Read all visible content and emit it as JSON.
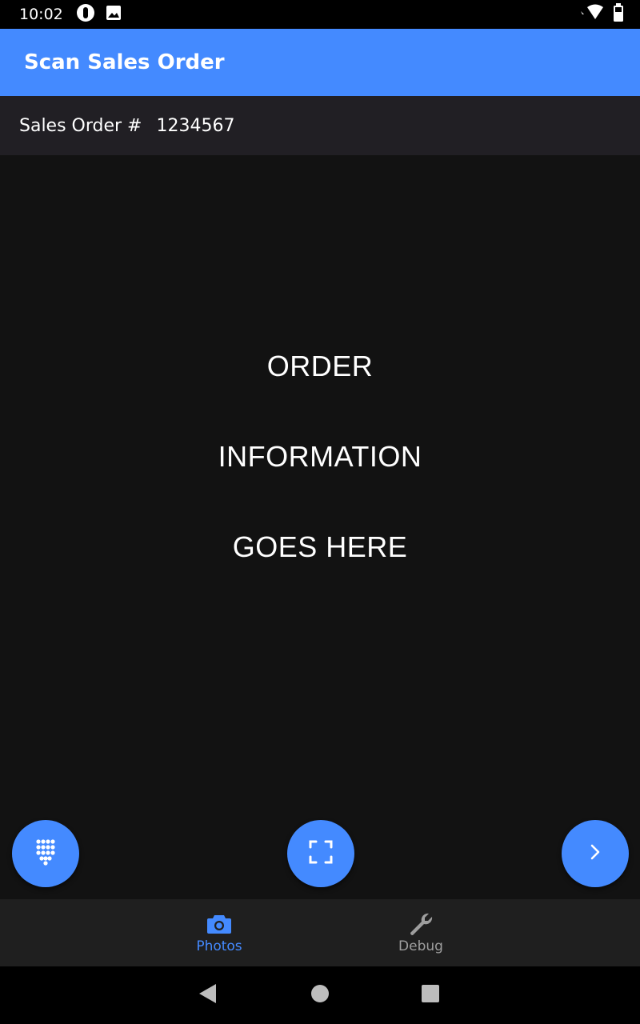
{
  "status_bar": {
    "time": "10:02",
    "left_icons": [
      "alert-icon",
      "image-icon"
    ],
    "right_icons": [
      "wifi-icon",
      "battery-icon"
    ]
  },
  "app_bar": {
    "title": "Scan Sales Order"
  },
  "order": {
    "label": "Sales Order #",
    "number": "1234567"
  },
  "main": {
    "lines": [
      "ORDER",
      "INFORMATION",
      "GOES HERE"
    ]
  },
  "fabs": {
    "left_icon": "dialpad-icon",
    "center_icon": "scan-frame-icon",
    "right_icon": "chevron-right-icon"
  },
  "bottom_nav": {
    "items": [
      {
        "label": "Photos",
        "icon": "camera-icon",
        "active": true
      },
      {
        "label": "Debug",
        "icon": "wrench-icon",
        "active": false
      }
    ]
  },
  "colors": {
    "accent": "#448aff",
    "background": "#121212",
    "order_row": "#211f24",
    "nav_bg": "#1f1f1f",
    "nav_inactive": "#9e9e9e"
  }
}
